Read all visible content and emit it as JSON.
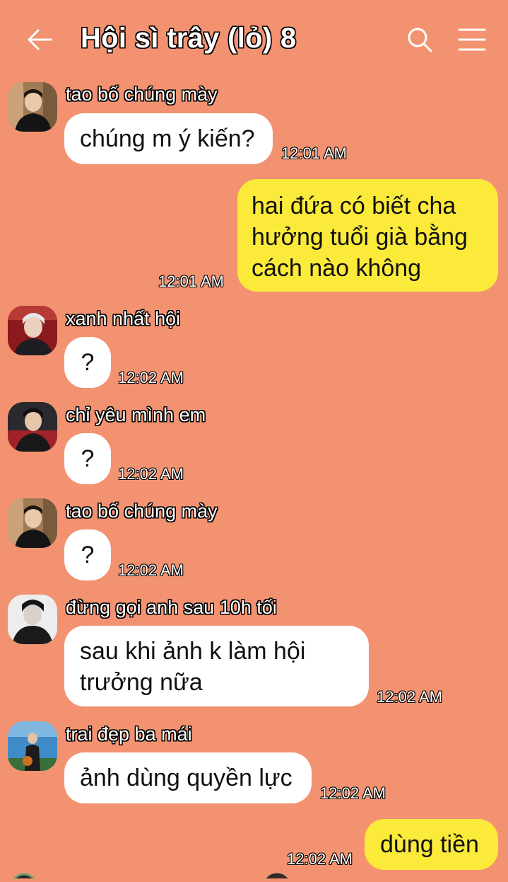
{
  "header": {
    "title": "Hội sì trây (lỏ) 8",
    "back_icon": "arrow-left-icon",
    "search_icon": "search-icon",
    "menu_icon": "hamburger-menu-icon"
  },
  "messages": [
    {
      "sender": "tao bố chúng mày",
      "text": "chúng m ý kiến?",
      "time": "12:01 AM"
    },
    {
      "sender": "",
      "text_lines": [
        "hai đứa có biết cha",
        "hưởng tuổi già bằng",
        "cách nào không"
      ],
      "time": "12:01 AM",
      "mine": true
    },
    {
      "sender": "xanh nhất hội",
      "text": "?",
      "time": "12:02 AM"
    },
    {
      "sender": "chỉ yêu mình em",
      "text": "?",
      "time": "12:02 AM"
    },
    {
      "sender": "tao bố chúng mày",
      "text": "?",
      "time": "12:02 AM"
    },
    {
      "sender": "đừng gọi anh sau 10h tối",
      "text_lines": [
        "sau khi ảnh k làm hội",
        "trưởng nữa"
      ],
      "time": "12:02 AM"
    },
    {
      "sender": "trai đẹp ba mái",
      "text": "ảnh dùng quyền lực",
      "time": "12:02 AM"
    },
    {
      "sender": "",
      "text": "dùng tiền",
      "time": "12:02 AM",
      "mine": true
    }
  ],
  "colors": {
    "background": "#f39270",
    "incoming_bubble": "#ffffff",
    "outgoing_bubble": "#fcea3a"
  }
}
